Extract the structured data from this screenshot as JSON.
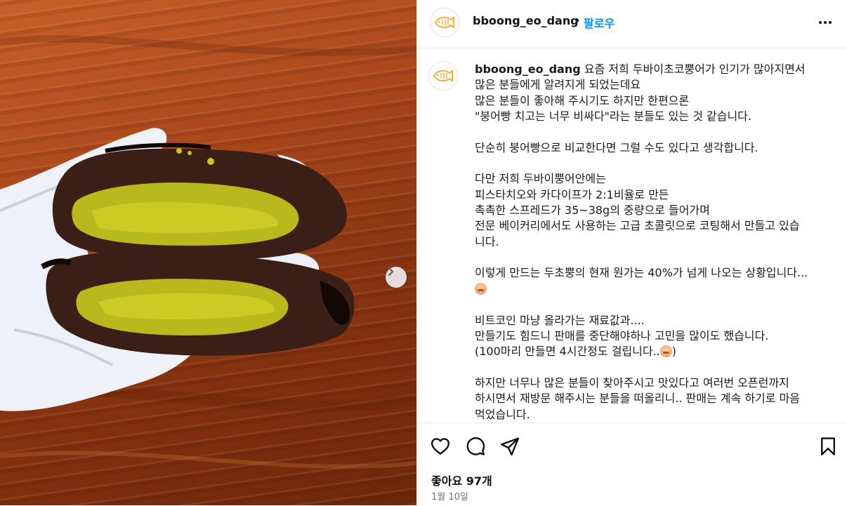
{
  "header": {
    "username": "bboong_eo_dang",
    "separator": "•",
    "follow_label": "팔로우"
  },
  "caption": {
    "username": "bboong_eo_dang",
    "lines": [
      "요즘 저희 두바이초코뿡어가 인기가 많아지면서",
      "많은 분들에게 알려지게 되었는데요",
      "많은 분들이 좋아해 주시기도 하지만 한편으론",
      "\"붕어빵 치고는 너무 비싸다\"라는 분들도 있는 것 같습니다.",
      "",
      "단순히 붕어빵으로 비교한다면 그럴 수도 있다고 생각합니다.",
      "",
      "다만 저희 두바이뿡어안에는",
      "피스타치오와 카다이프가 2:1비율로 만든",
      "촉촉한 스프레드가 35~38g의 중량으로 들어가며",
      "전문 베이커리에서도 사용하는 고급 초콜릿으로 코팅해서 만들고 있습",
      "니다.",
      "",
      "이렇게 만드는 두초뿡의 현재 원가는 40%가 넘게 나오는 상황입니다...",
      "",
      "",
      "비트코인 마냥 올라가는 재료값과....",
      "만들기도 힘드니 판매를 중단해야하나 고민을 많이도 했습니다.",
      "(100마리 만들면 4시간정도 걸립니다..",
      "",
      "하지만 너무나 많은 분들이 찾아주시고 맛있다고 여러번 오픈런까지",
      "하시면서 재방문 해주시는 분들을 떠올리니.. 판매는 계속 하기로 마음",
      "먹었습니다."
    ],
    "paren_close": ")"
  },
  "actions": {
    "likes": "좋아요 97개",
    "date": "1월 10일"
  },
  "icons": {
    "avatar": "taiyaki-logo-icon",
    "more": "more-options-icon",
    "like": "heart-icon",
    "comment": "comment-icon",
    "share": "send-icon",
    "save": "bookmark-icon",
    "next": "chevron-right-icon"
  },
  "colors": {
    "accent": "#0095f6",
    "logo_orange": "#f5a623"
  }
}
